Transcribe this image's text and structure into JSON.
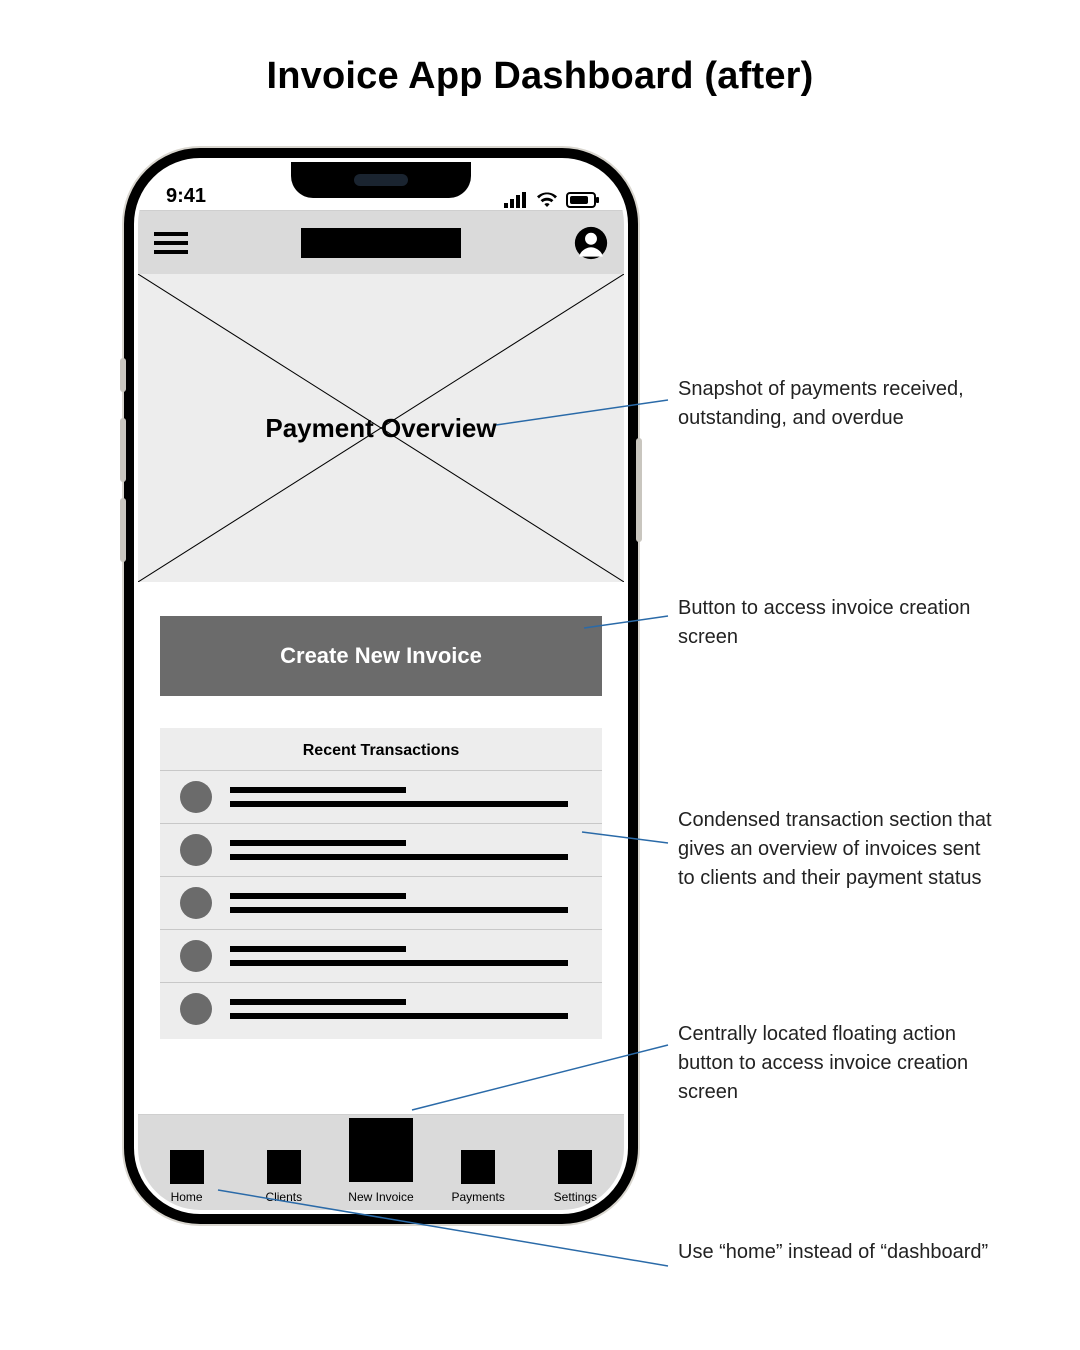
{
  "page_title": "Invoice App Dashboard (after)",
  "status_bar": {
    "time": "9:41"
  },
  "overview": {
    "title": "Payment Overview"
  },
  "cta": {
    "label": "Create New Invoice"
  },
  "recent": {
    "title": "Recent Transactions",
    "rows": 5
  },
  "bottom_nav": {
    "items": [
      {
        "label": "Home"
      },
      {
        "label": "Clients"
      },
      {
        "label": "New Invoice",
        "primary": true
      },
      {
        "label": "Payments"
      },
      {
        "label": "Settings"
      }
    ]
  },
  "annotations": [
    {
      "text": "Snapshot of payments received, outstanding, and overdue"
    },
    {
      "text": "Button to access invoice creation screen"
    },
    {
      "text": "Condensed transaction section that gives an overview of invoices sent to clients and their payment status"
    },
    {
      "text": "Centrally located floating action button to access invoice creation screen"
    },
    {
      "text": "Use “home” instead of “dashboard”"
    }
  ]
}
